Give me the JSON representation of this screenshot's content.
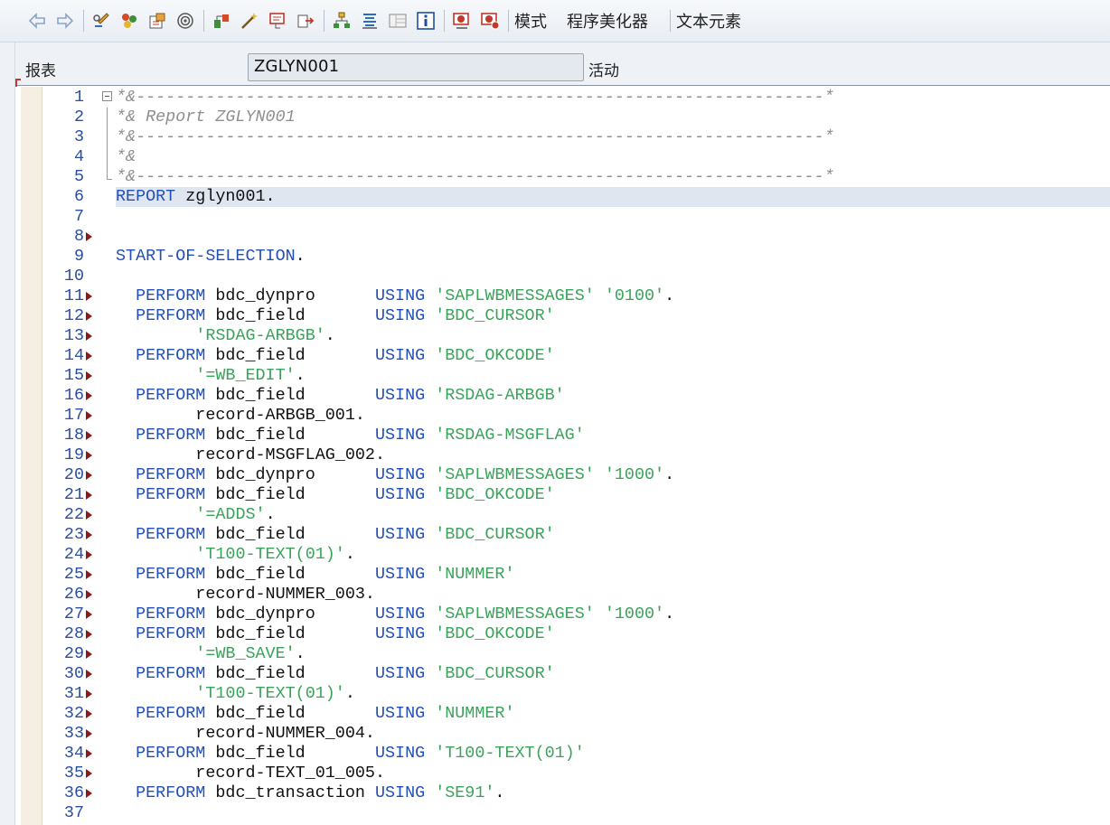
{
  "toolbar": {
    "buttons": [
      {
        "name": "back-arrow-icon",
        "group": 0
      },
      {
        "name": "forward-arrow-icon",
        "group": 0
      },
      {
        "name": "toggle-display-change-icon",
        "group": 1
      },
      {
        "name": "other-object-icon",
        "group": 1
      },
      {
        "name": "activate-icon",
        "group": 1
      },
      {
        "name": "where-used-icon",
        "group": 1
      },
      {
        "name": "check-syntax-icon",
        "group": 2
      },
      {
        "name": "activate-wand-icon",
        "group": 2
      },
      {
        "name": "test-run-icon",
        "group": 2
      },
      {
        "name": "navigate-icon",
        "group": 2
      },
      {
        "name": "object-list-icon",
        "group": 3
      },
      {
        "name": "display-hierarchy-icon",
        "group": 3
      },
      {
        "name": "window-layout-icon",
        "group": 3
      },
      {
        "name": "info-icon",
        "group": 3
      },
      {
        "name": "breakpoint-session-icon",
        "group": 4
      },
      {
        "name": "breakpoint-external-icon",
        "group": 4
      }
    ],
    "text_buttons": {
      "pattern": "模式",
      "pretty_printer": "程序美化器",
      "text_elements": "文本元素"
    }
  },
  "header": {
    "label": "报表",
    "program_name": "ZGLYN001",
    "status": "活动"
  },
  "editor": {
    "highlighted_line": 6,
    "lines": [
      {
        "n": "1",
        "bp": false,
        "fold": "start",
        "segs": [
          [
            "cmt",
            "*&---------------------------------------------------------------------*"
          ]
        ]
      },
      {
        "n": "2",
        "bp": false,
        "fold": "mid",
        "segs": [
          [
            "cmt",
            "*& Report ZGLYN001"
          ]
        ]
      },
      {
        "n": "3",
        "bp": false,
        "fold": "mid",
        "segs": [
          [
            "cmt",
            "*&---------------------------------------------------------------------*"
          ]
        ]
      },
      {
        "n": "4",
        "bp": false,
        "fold": "mid",
        "segs": [
          [
            "cmt",
            "*&"
          ]
        ]
      },
      {
        "n": "5",
        "bp": false,
        "fold": "end",
        "segs": [
          [
            "cmt",
            "*&---------------------------------------------------------------------*"
          ]
        ]
      },
      {
        "n": "6",
        "bp": false,
        "fold": "",
        "segs": [
          [
            "kw",
            "REPORT"
          ],
          [
            "txt",
            " zglyn001."
          ]
        ]
      },
      {
        "n": "7",
        "bp": false,
        "fold": "",
        "segs": []
      },
      {
        "n": "8",
        "bp": true,
        "fold": "",
        "segs": []
      },
      {
        "n": "9",
        "bp": false,
        "fold": "",
        "segs": [
          [
            "kw",
            "START-OF-SELECTION"
          ],
          [
            "txt",
            "."
          ]
        ]
      },
      {
        "n": "10",
        "bp": false,
        "fold": "",
        "segs": []
      },
      {
        "n": "11",
        "bp": true,
        "fold": "",
        "segs": [
          [
            "txt",
            "  "
          ],
          [
            "kw",
            "PERFORM"
          ],
          [
            "txt",
            " bdc_dynpro      "
          ],
          [
            "kw",
            "USING"
          ],
          [
            "txt",
            " "
          ],
          [
            "str",
            "'SAPLWBMESSAGES'"
          ],
          [
            "txt",
            " "
          ],
          [
            "str",
            "'0100'"
          ],
          [
            "txt",
            "."
          ]
        ]
      },
      {
        "n": "12",
        "bp": true,
        "fold": "",
        "segs": [
          [
            "txt",
            "  "
          ],
          [
            "kw",
            "PERFORM"
          ],
          [
            "txt",
            " bdc_field       "
          ],
          [
            "kw",
            "USING"
          ],
          [
            "txt",
            " "
          ],
          [
            "str",
            "'BDC_CURSOR'"
          ]
        ]
      },
      {
        "n": "13",
        "bp": true,
        "fold": "",
        "segs": [
          [
            "txt",
            "        "
          ],
          [
            "str",
            "'RSDAG-ARBGB'"
          ],
          [
            "txt",
            "."
          ]
        ]
      },
      {
        "n": "14",
        "bp": true,
        "fold": "",
        "segs": [
          [
            "txt",
            "  "
          ],
          [
            "kw",
            "PERFORM"
          ],
          [
            "txt",
            " bdc_field       "
          ],
          [
            "kw",
            "USING"
          ],
          [
            "txt",
            " "
          ],
          [
            "str",
            "'BDC_OKCODE'"
          ]
        ]
      },
      {
        "n": "15",
        "bp": true,
        "fold": "",
        "segs": [
          [
            "txt",
            "        "
          ],
          [
            "str",
            "'=WB_EDIT'"
          ],
          [
            "txt",
            "."
          ]
        ]
      },
      {
        "n": "16",
        "bp": true,
        "fold": "",
        "segs": [
          [
            "txt",
            "  "
          ],
          [
            "kw",
            "PERFORM"
          ],
          [
            "txt",
            " bdc_field       "
          ],
          [
            "kw",
            "USING"
          ],
          [
            "txt",
            " "
          ],
          [
            "str",
            "'RSDAG-ARBGB'"
          ]
        ]
      },
      {
        "n": "17",
        "bp": true,
        "fold": "",
        "segs": [
          [
            "txt",
            "        record-ARBGB_001."
          ]
        ]
      },
      {
        "n": "18",
        "bp": true,
        "fold": "",
        "segs": [
          [
            "txt",
            "  "
          ],
          [
            "kw",
            "PERFORM"
          ],
          [
            "txt",
            " bdc_field       "
          ],
          [
            "kw",
            "USING"
          ],
          [
            "txt",
            " "
          ],
          [
            "str",
            "'RSDAG-MSGFLAG'"
          ]
        ]
      },
      {
        "n": "19",
        "bp": true,
        "fold": "",
        "segs": [
          [
            "txt",
            "        record-MSGFLAG_002."
          ]
        ]
      },
      {
        "n": "20",
        "bp": true,
        "fold": "",
        "segs": [
          [
            "txt",
            "  "
          ],
          [
            "kw",
            "PERFORM"
          ],
          [
            "txt",
            " bdc_dynpro      "
          ],
          [
            "kw",
            "USING"
          ],
          [
            "txt",
            " "
          ],
          [
            "str",
            "'SAPLWBMESSAGES'"
          ],
          [
            "txt",
            " "
          ],
          [
            "str",
            "'1000'"
          ],
          [
            "txt",
            "."
          ]
        ]
      },
      {
        "n": "21",
        "bp": true,
        "fold": "",
        "segs": [
          [
            "txt",
            "  "
          ],
          [
            "kw",
            "PERFORM"
          ],
          [
            "txt",
            " bdc_field       "
          ],
          [
            "kw",
            "USING"
          ],
          [
            "txt",
            " "
          ],
          [
            "str",
            "'BDC_OKCODE'"
          ]
        ]
      },
      {
        "n": "22",
        "bp": true,
        "fold": "",
        "segs": [
          [
            "txt",
            "        "
          ],
          [
            "str",
            "'=ADDS'"
          ],
          [
            "txt",
            "."
          ]
        ]
      },
      {
        "n": "23",
        "bp": true,
        "fold": "",
        "segs": [
          [
            "txt",
            "  "
          ],
          [
            "kw",
            "PERFORM"
          ],
          [
            "txt",
            " bdc_field       "
          ],
          [
            "kw",
            "USING"
          ],
          [
            "txt",
            " "
          ],
          [
            "str",
            "'BDC_CURSOR'"
          ]
        ]
      },
      {
        "n": "24",
        "bp": true,
        "fold": "",
        "segs": [
          [
            "txt",
            "        "
          ],
          [
            "str",
            "'T100-TEXT(01)'"
          ],
          [
            "txt",
            "."
          ]
        ]
      },
      {
        "n": "25",
        "bp": true,
        "fold": "",
        "segs": [
          [
            "txt",
            "  "
          ],
          [
            "kw",
            "PERFORM"
          ],
          [
            "txt",
            " bdc_field       "
          ],
          [
            "kw",
            "USING"
          ],
          [
            "txt",
            " "
          ],
          [
            "str",
            "'NUMMER'"
          ]
        ]
      },
      {
        "n": "26",
        "bp": true,
        "fold": "",
        "segs": [
          [
            "txt",
            "        record-NUMMER_003."
          ]
        ]
      },
      {
        "n": "27",
        "bp": true,
        "fold": "",
        "segs": [
          [
            "txt",
            "  "
          ],
          [
            "kw",
            "PERFORM"
          ],
          [
            "txt",
            " bdc_dynpro      "
          ],
          [
            "kw",
            "USING"
          ],
          [
            "txt",
            " "
          ],
          [
            "str",
            "'SAPLWBMESSAGES'"
          ],
          [
            "txt",
            " "
          ],
          [
            "str",
            "'1000'"
          ],
          [
            "txt",
            "."
          ]
        ]
      },
      {
        "n": "28",
        "bp": true,
        "fold": "",
        "segs": [
          [
            "txt",
            "  "
          ],
          [
            "kw",
            "PERFORM"
          ],
          [
            "txt",
            " bdc_field       "
          ],
          [
            "kw",
            "USING"
          ],
          [
            "txt",
            " "
          ],
          [
            "str",
            "'BDC_OKCODE'"
          ]
        ]
      },
      {
        "n": "29",
        "bp": true,
        "fold": "",
        "segs": [
          [
            "txt",
            "        "
          ],
          [
            "str",
            "'=WB_SAVE'"
          ],
          [
            "txt",
            "."
          ]
        ]
      },
      {
        "n": "30",
        "bp": true,
        "fold": "",
        "segs": [
          [
            "txt",
            "  "
          ],
          [
            "kw",
            "PERFORM"
          ],
          [
            "txt",
            " bdc_field       "
          ],
          [
            "kw",
            "USING"
          ],
          [
            "txt",
            " "
          ],
          [
            "str",
            "'BDC_CURSOR'"
          ]
        ]
      },
      {
        "n": "31",
        "bp": true,
        "fold": "",
        "segs": [
          [
            "txt",
            "        "
          ],
          [
            "str",
            "'T100-TEXT(01)'"
          ],
          [
            "txt",
            "."
          ]
        ]
      },
      {
        "n": "32",
        "bp": true,
        "fold": "",
        "segs": [
          [
            "txt",
            "  "
          ],
          [
            "kw",
            "PERFORM"
          ],
          [
            "txt",
            " bdc_field       "
          ],
          [
            "kw",
            "USING"
          ],
          [
            "txt",
            " "
          ],
          [
            "str",
            "'NUMMER'"
          ]
        ]
      },
      {
        "n": "33",
        "bp": true,
        "fold": "",
        "segs": [
          [
            "txt",
            "        record-NUMMER_004."
          ]
        ]
      },
      {
        "n": "34",
        "bp": true,
        "fold": "",
        "segs": [
          [
            "txt",
            "  "
          ],
          [
            "kw",
            "PERFORM"
          ],
          [
            "txt",
            " bdc_field       "
          ],
          [
            "kw",
            "USING"
          ],
          [
            "txt",
            " "
          ],
          [
            "str",
            "'T100-TEXT(01)'"
          ]
        ]
      },
      {
        "n": "35",
        "bp": true,
        "fold": "",
        "segs": [
          [
            "txt",
            "        record-TEXT_01_005."
          ]
        ]
      },
      {
        "n": "36",
        "bp": true,
        "fold": "",
        "segs": [
          [
            "txt",
            "  "
          ],
          [
            "kw",
            "PERFORM"
          ],
          [
            "txt",
            " bdc_transaction "
          ],
          [
            "kw",
            "USING"
          ],
          [
            "txt",
            " "
          ],
          [
            "str",
            "'SE91'"
          ],
          [
            "txt",
            "."
          ]
        ]
      },
      {
        "n": "37",
        "bp": false,
        "fold": "",
        "segs": []
      }
    ]
  },
  "colors": {
    "keyword": "#2350b5",
    "string": "#3aa35a",
    "comment": "#8f8f8f",
    "line_number": "#2a4ea0",
    "breakpoint": "#8b1a1a",
    "highlight": "#dfe6f0"
  }
}
